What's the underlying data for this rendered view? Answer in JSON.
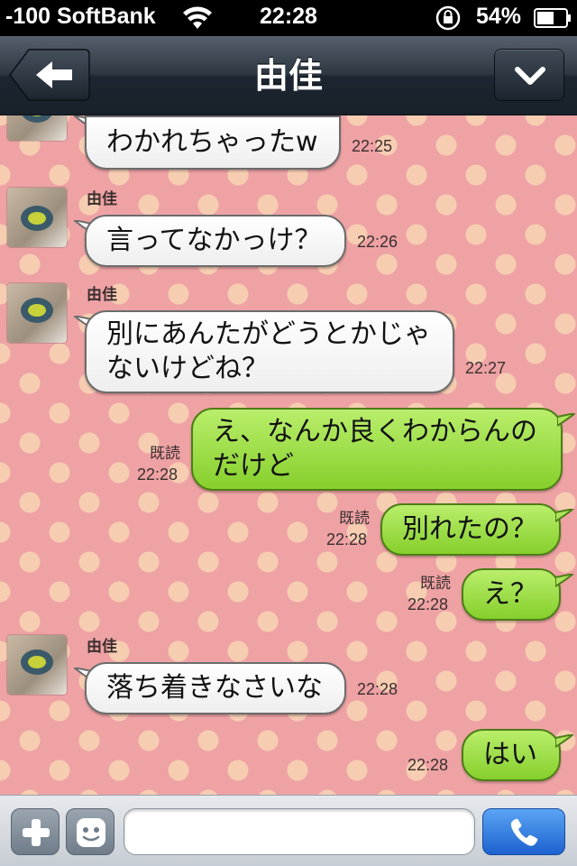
{
  "status_bar": {
    "carrier": "-100 SoftBank",
    "time": "22:28",
    "battery": "54%"
  },
  "nav": {
    "title": "由佳",
    "back_icon": "back-arrow-icon",
    "menu_icon": "chevron-down-icon"
  },
  "messages": [
    {
      "side": "in",
      "sender": "",
      "text": "わかれちゃったw",
      "time": "22:25"
    },
    {
      "side": "in",
      "sender": "由佳",
      "text": "言ってなかっけ？",
      "time": "22:26"
    },
    {
      "side": "in",
      "sender": "由佳",
      "lines": [
        "別にあんたがどうとかじゃ",
        "ないけどね？"
      ],
      "time": "22:27"
    },
    {
      "side": "out",
      "read": "既読",
      "lines": [
        "え、なんか良くわからんの",
        "だけど"
      ],
      "time": "22:28"
    },
    {
      "side": "out",
      "read": "既読",
      "text": "別れたの？",
      "time": "22:28"
    },
    {
      "side": "out",
      "read": "既読",
      "text": "え？",
      "time": "22:28"
    },
    {
      "side": "in",
      "sender": "由佳",
      "text": "落ち着きなさいな",
      "time": "22:28"
    },
    {
      "side": "out",
      "read": "",
      "text": "はい",
      "time": "22:28"
    }
  ],
  "input_bar": {
    "placeholder": "",
    "plus_icon": "plus-icon",
    "emoji_icon": "emoji-icon",
    "call_icon": "phone-icon"
  },
  "colors": {
    "background": "#eea2a4",
    "outgoing_bubble": "#9ee04a",
    "incoming_bubble": "#ffffff",
    "call_button": "#2f7be0"
  }
}
